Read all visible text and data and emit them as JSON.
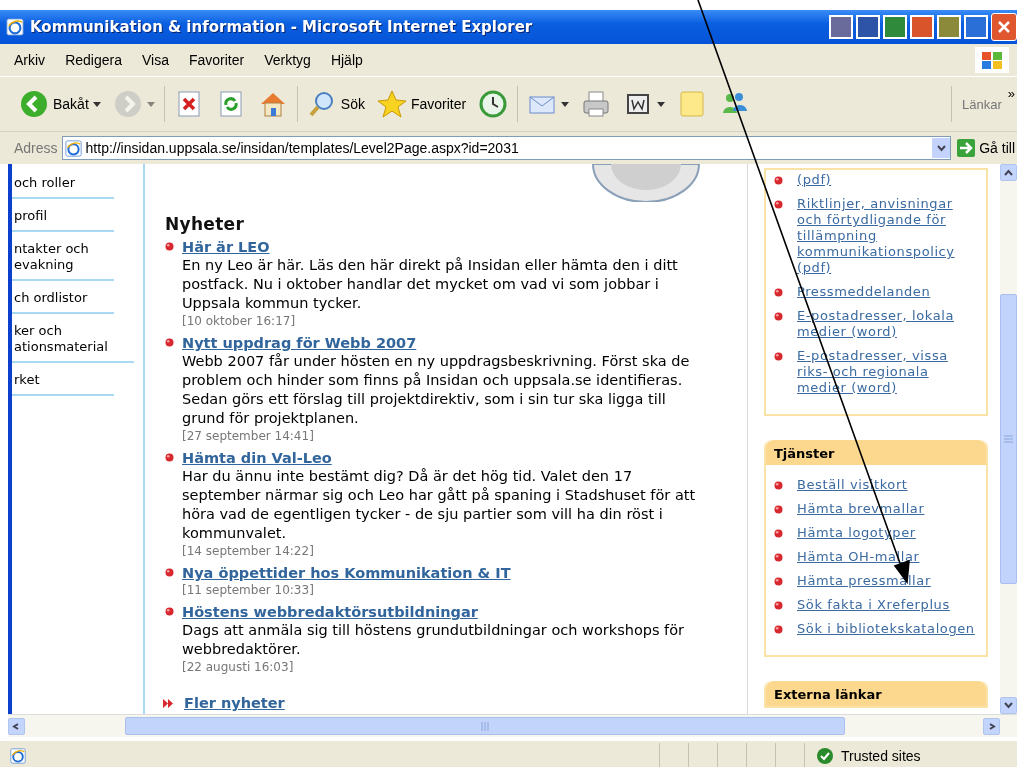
{
  "window": {
    "title": "Kommunikation & information - Microsoft Internet Explorer"
  },
  "menu": [
    "Arkiv",
    "Redigera",
    "Visa",
    "Favoriter",
    "Verktyg",
    "Hjälp"
  ],
  "toolbar": [
    {
      "kind": "back",
      "label": "Bakåt",
      "dropdown": true,
      "disabled": false
    },
    {
      "kind": "forward",
      "dropdown": true,
      "disabled": true
    },
    {
      "kind": "stop",
      "dropdown": false,
      "disabled": false
    },
    {
      "kind": "refresh",
      "dropdown": false,
      "disabled": false
    },
    {
      "kind": "home",
      "dropdown": false,
      "disabled": false
    },
    {
      "kind": "search",
      "label": "Sök",
      "dropdown": false,
      "disabled": false
    },
    {
      "kind": "favorites",
      "label": "Favoriter",
      "dropdown": false,
      "disabled": false
    },
    {
      "kind": "history",
      "dropdown": false,
      "disabled": false
    },
    {
      "kind": "mail",
      "dropdown": true,
      "disabled": false
    },
    {
      "kind": "print",
      "dropdown": false,
      "disabled": false
    },
    {
      "kind": "word",
      "dropdown": true,
      "disabled": false
    },
    {
      "kind": "note",
      "dropdown": false,
      "disabled": false
    },
    {
      "kind": "messenger",
      "dropdown": false,
      "disabled": false
    }
  ],
  "links_bar": {
    "label": "Länkar",
    "more": "»"
  },
  "address": {
    "label": "Adress",
    "url": "http://insidan.uppsala.se/insidan/templates/Level2Page.aspx?id=2031",
    "go_label": "Gå till"
  },
  "sidebar": {
    "items": [
      {
        "lines": [
          "och roller"
        ]
      },
      {
        "lines": [
          "profil"
        ]
      },
      {
        "lines": [
          "ntakter och",
          "evakning"
        ]
      },
      {
        "lines": [
          "ch ordlistor"
        ]
      },
      {
        "lines": [
          "ker och",
          "ationsmaterial"
        ]
      },
      {
        "lines": [
          "rket"
        ]
      }
    ]
  },
  "news": {
    "heading": "Nyheter",
    "items": [
      {
        "title": "Här är LEO",
        "body": "En ny Leo är här. Läs den här direkt på Insidan eller hämta den i ditt postfack. Nu i oktober handlar det mycket om vad vi som jobbar i Uppsala kommun tycker.",
        "date": "[10 oktober 16:17]"
      },
      {
        "title": "Nytt uppdrag för Webb 2007",
        "body": "Webb 2007 får under hösten en ny uppdragsbeskrivning. Först ska de problem och hinder som finns på Insidan och uppsala.se identifieras. Sedan görs ett förslag till projektdirektiv, som i sin tur ska ligga till grund för projektplanen.",
        "date": "[27 september 14:41]"
      },
      {
        "title": "Hämta din Val-Leo",
        "body": "Har du ännu inte bestämt dig? Då är det hög tid. Valet den 17 september närmar sig och Leo har gått på spaning i Stadshuset för att höra vad de egentligen tycker - de sju partier som vill ha din röst i kommunvalet.",
        "date": "[14 september 14:22]"
      },
      {
        "title": "Nya öppettider hos Kommunikation & IT",
        "date": "[11 september 10:33]"
      },
      {
        "title": "Höstens webbredaktörsutbildningar",
        "body": "Dags att anmäla sig till höstens grundutbildningar och workshops för webbredaktörer.",
        "date": "[22 augusti 16:03]"
      }
    ],
    "more": "Fler nyheter"
  },
  "panels": [
    {
      "links": [
        "(pdf)",
        "Riktlinjer, anvisningar och förtydligande för tillämpning kommunikationspolicy (pdf)",
        "Pressmeddelanden",
        "E-postadresser, lokala medier (word)",
        "E-postadresser, vissa riks- och regionala medier (word)"
      ]
    },
    {
      "title": "Tjänster",
      "links": [
        "Beställ visitkort",
        "Hämta brevmallar",
        "Hämta logotyper",
        "Hämta OH-mallar",
        "Hämta pressmallar",
        "Sök fakta i Xreferplus",
        "Sök i bibliotekskatalogen"
      ]
    },
    {
      "title": "Externa länkar"
    }
  ],
  "status_bar": {
    "zone": "Trusted sites"
  }
}
